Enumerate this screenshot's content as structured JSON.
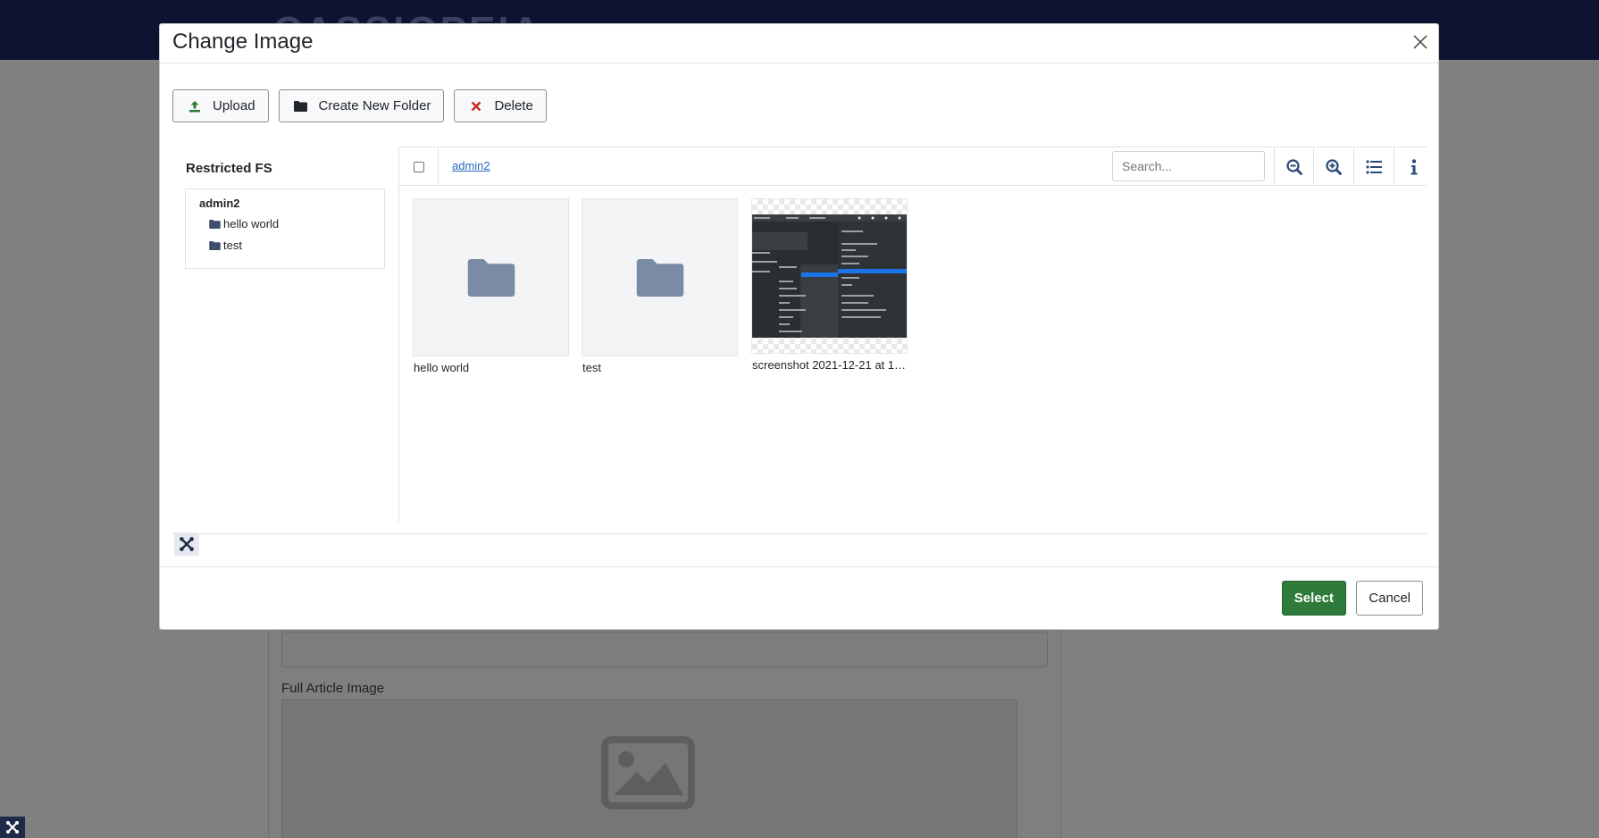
{
  "background": {
    "header_logo_text": "CASSIOPEIA",
    "field_label": "Full Article Image"
  },
  "modal": {
    "title": "Change Image",
    "close_icon": "close-icon",
    "toolbar": {
      "upload": "Upload",
      "create_folder": "Create New Folder",
      "delete": "Delete"
    },
    "sidebar": {
      "title": "Restricted FS",
      "root": "admin2",
      "folders": [
        {
          "label": "hello world"
        },
        {
          "label": "test"
        }
      ]
    },
    "browser": {
      "breadcrumb": "admin2",
      "search_placeholder": "Search...",
      "items": [
        {
          "name": "hello world",
          "type": "folder"
        },
        {
          "name": "test",
          "type": "folder"
        },
        {
          "name": "screenshot 2021-12-21 at 17...",
          "type": "image"
        }
      ]
    },
    "footer": {
      "select": "Select",
      "cancel": "Cancel"
    }
  },
  "colors": {
    "primary_green": "#2e7b3b",
    "delete_red": "#c52827",
    "upload_green": "#2e7b3b",
    "folder_icon": "#7a8ca5",
    "link_blue": "#2a69b8",
    "header_bg": "#0d1330"
  }
}
